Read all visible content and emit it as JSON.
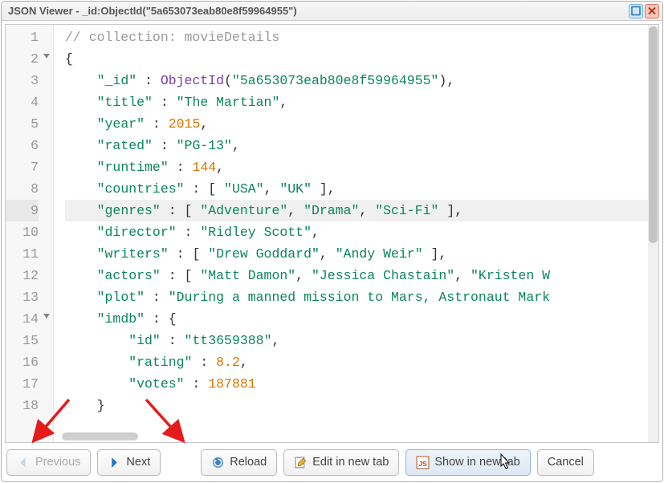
{
  "window": {
    "title": "JSON Viewer - _id:ObjectId(\"5a653073eab80e8f59964955\")"
  },
  "code": {
    "lines": [
      "// collection: movieDetails",
      "{",
      "    \"_id\" : ObjectId(\"5a653073eab80e8f59964955\"),",
      "    \"title\" : \"The Martian\",",
      "    \"year\" : 2015,",
      "    \"rated\" : \"PG-13\",",
      "    \"runtime\" : 144,",
      "    \"countries\" : [ \"USA\", \"UK\" ],",
      "    \"genres\" : [ \"Adventure\", \"Drama\", \"Sci-Fi\" ],",
      "    \"director\" : \"Ridley Scott\",",
      "    \"writers\" : [ \"Drew Goddard\", \"Andy Weir\" ],",
      "    \"actors\" : [ \"Matt Damon\", \"Jessica Chastain\", \"Kristen W",
      "    \"plot\" : \"During a manned mission to Mars, Astronaut Mark",
      "    \"imdb\" : {",
      "        \"id\" : \"tt3659388\",",
      "        \"rating\" : 8.2,",
      "        \"votes\" : 187881",
      "    }"
    ],
    "objectid_arg": "5a653073eab80e8f59964955",
    "highlighted_line": 9,
    "fold_lines": [
      2,
      14
    ]
  },
  "buttons": {
    "previous": "Previous",
    "next": "Next",
    "reload": "Reload",
    "edit": "Edit in new tab",
    "show": "Show in new tab",
    "cancel": "Cancel"
  }
}
